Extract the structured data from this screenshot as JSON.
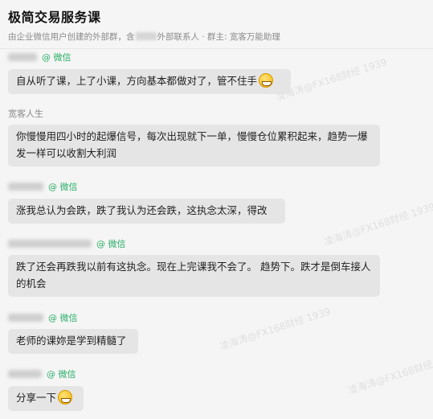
{
  "header": {
    "title": "极简交易服务课",
    "subtitle_part1": "由企业微信用户创建的外部群，含",
    "subtitle_part2": "外部联系人 · 群主: 宽客万能助理"
  },
  "messages": [
    {
      "sender_tag": "@ 微信",
      "text": "自从听了课，上了小课，方向基本都做对了，管不住手",
      "emoji": "grinning-sweat-icon"
    },
    {
      "sender_name": "宽客人生",
      "text": "你慢慢用四小时的起爆信号，每次出现就下一单，慢慢仓位累积起来，趋势一爆发一样可以收割大利润"
    },
    {
      "sender_tag": "@ 微信",
      "text": "涨我总认为会跌，跌了我认为还会跌，这执念太深，得改"
    },
    {
      "sender_tag": "@ 微信",
      "text": "跌了还会再跌我以前有这执念。现在上完课我不会了。  趋势下。跌才是倒车接人的机会"
    },
    {
      "sender_tag": "@ 微信",
      "text": "老师的课妳是学到精髓了"
    },
    {
      "sender_tag": "@ 微信",
      "text": "分享一下",
      "emoji": "grinning-icon"
    }
  ],
  "watermark": "凌海涛@FX168财经 1939"
}
